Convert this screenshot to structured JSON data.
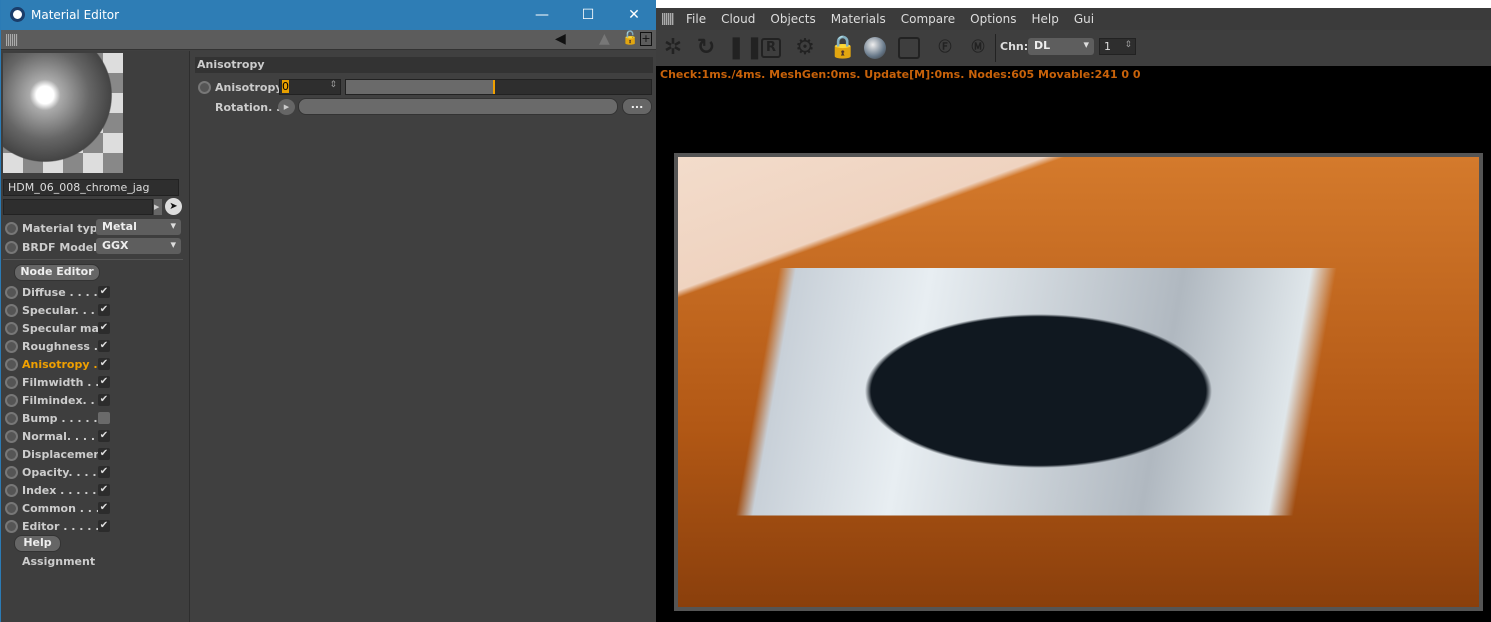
{
  "editor": {
    "title": "Material Editor",
    "controls": {
      "minimize": "—",
      "maximize": "☐",
      "close": "✕"
    },
    "material_name": "HDM_06_008_chrome_jag",
    "material_type": {
      "label": "Material type",
      "value": "Metal"
    },
    "brdf_model": {
      "label": "BRDF Model",
      "value": "GGX"
    },
    "node_editor": "Node Editor",
    "channels": [
      {
        "label": "Diffuse . . . . .",
        "checked": true
      },
      {
        "label": "Specular. . . .",
        "checked": true
      },
      {
        "label": "Specular map",
        "checked": true
      },
      {
        "label": "Roughness  .",
        "checked": true
      },
      {
        "label": "Anisotropy  .",
        "checked": true,
        "active": true
      },
      {
        "label": "Filmwidth  . .",
        "checked": true
      },
      {
        "label": "Filmindex. . .",
        "checked": true
      },
      {
        "label": "Bump . . . . . .",
        "checked": false
      },
      {
        "label": "Normal. . . . .",
        "checked": true
      },
      {
        "label": "Displacement",
        "checked": true
      },
      {
        "label": "Opacity. . . . .",
        "checked": true
      },
      {
        "label": "Index . . . . . .",
        "checked": true
      },
      {
        "label": "Common . . .",
        "checked": true
      },
      {
        "label": "Editor . . . . . .",
        "checked": true
      }
    ],
    "help": "Help",
    "assignment": "Assignment",
    "section": "Anisotropy",
    "anisotropy": {
      "label": "Anisotropy",
      "value": "0",
      "slider_fraction": 0.49
    },
    "rotation": {
      "label": "Rotation. .",
      "more": "..."
    }
  },
  "viewer": {
    "menu": [
      "File",
      "Cloud",
      "Objects",
      "Materials",
      "Compare",
      "Options",
      "Help",
      "Gui"
    ],
    "channel_label": "Chn:",
    "channel_value": "DL",
    "pass_value": "1",
    "status": "Check:1ms./4ms. MeshGen:0ms. Update[M]:0ms. Nodes:605 Movable:241  0 0",
    "accent": "#c8620a",
    "lock_color": "#e8b400"
  }
}
